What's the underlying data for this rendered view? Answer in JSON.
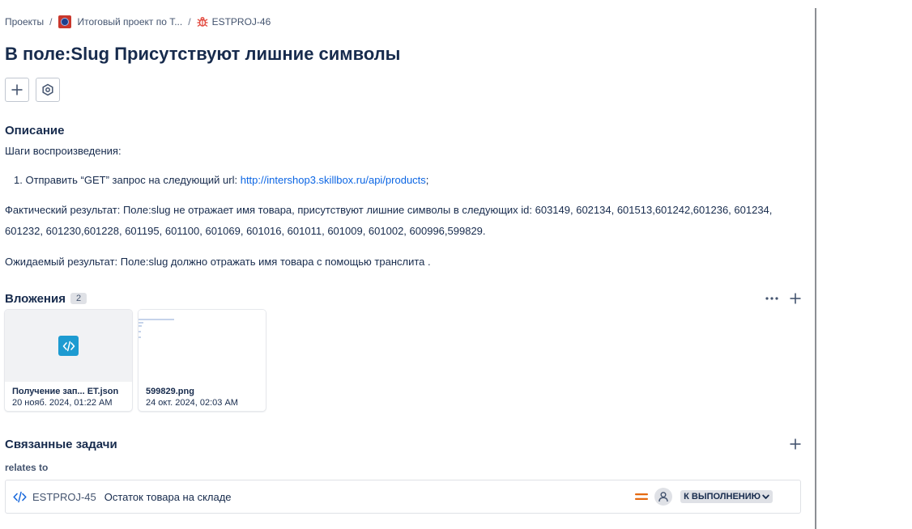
{
  "breadcrumb": {
    "projects": "Проекты",
    "project": "Итоговый проект по Т...",
    "issue_key": "ESTPROJ-46"
  },
  "issue": {
    "title": "В поле:Slug Присутствуют лишние символы"
  },
  "description": {
    "heading": "Описание",
    "steps_label": "Шаги воспроизведения:",
    "step_prefix": "1. Отправить “GET” запрос на следующий url: ",
    "step_link": "http://intershop3.skillbox.ru/api/products",
    "step_suffix": ";",
    "actual": "Фактический результат: Поле:slug не отражает имя товара, присутствуют лишние символы в следующих id: 603149, 602134, 601513,601242,601236, 601234, 601232, 601230,601228, 601195, 601100, 601069, 601016, 601011, 601009, 601002, 600996,599829.",
    "expected": "Ожидаемый результат:  Поле:slug должно отражать имя товара с помощью транслита ."
  },
  "attachments": {
    "heading": "Вложения",
    "count": "2",
    "items": [
      {
        "name": "Получение зап...   ET.json",
        "date": "20 нояб. 2024, 01:22 AM",
        "icon": "code-icon"
      },
      {
        "name": "599829.png",
        "date": "24 окт. 2024, 02:03 AM",
        "icon": "image-thumbnail"
      }
    ]
  },
  "linked": {
    "heading": "Связанные задачи",
    "relation": "relates to",
    "items": [
      {
        "key": "ESTPROJ-45",
        "summary": "Остаток товара на складе",
        "status": "К ВЫПОЛНЕНИЮ",
        "priority": "medium-priority-icon"
      }
    ]
  },
  "colors": {
    "link": "#0c66e4",
    "project_avatar": "#c9372c",
    "bug": "#e2483d",
    "priority": "#e56910",
    "code_tile": "#1d9bd1",
    "divider": "#8c8f94"
  }
}
